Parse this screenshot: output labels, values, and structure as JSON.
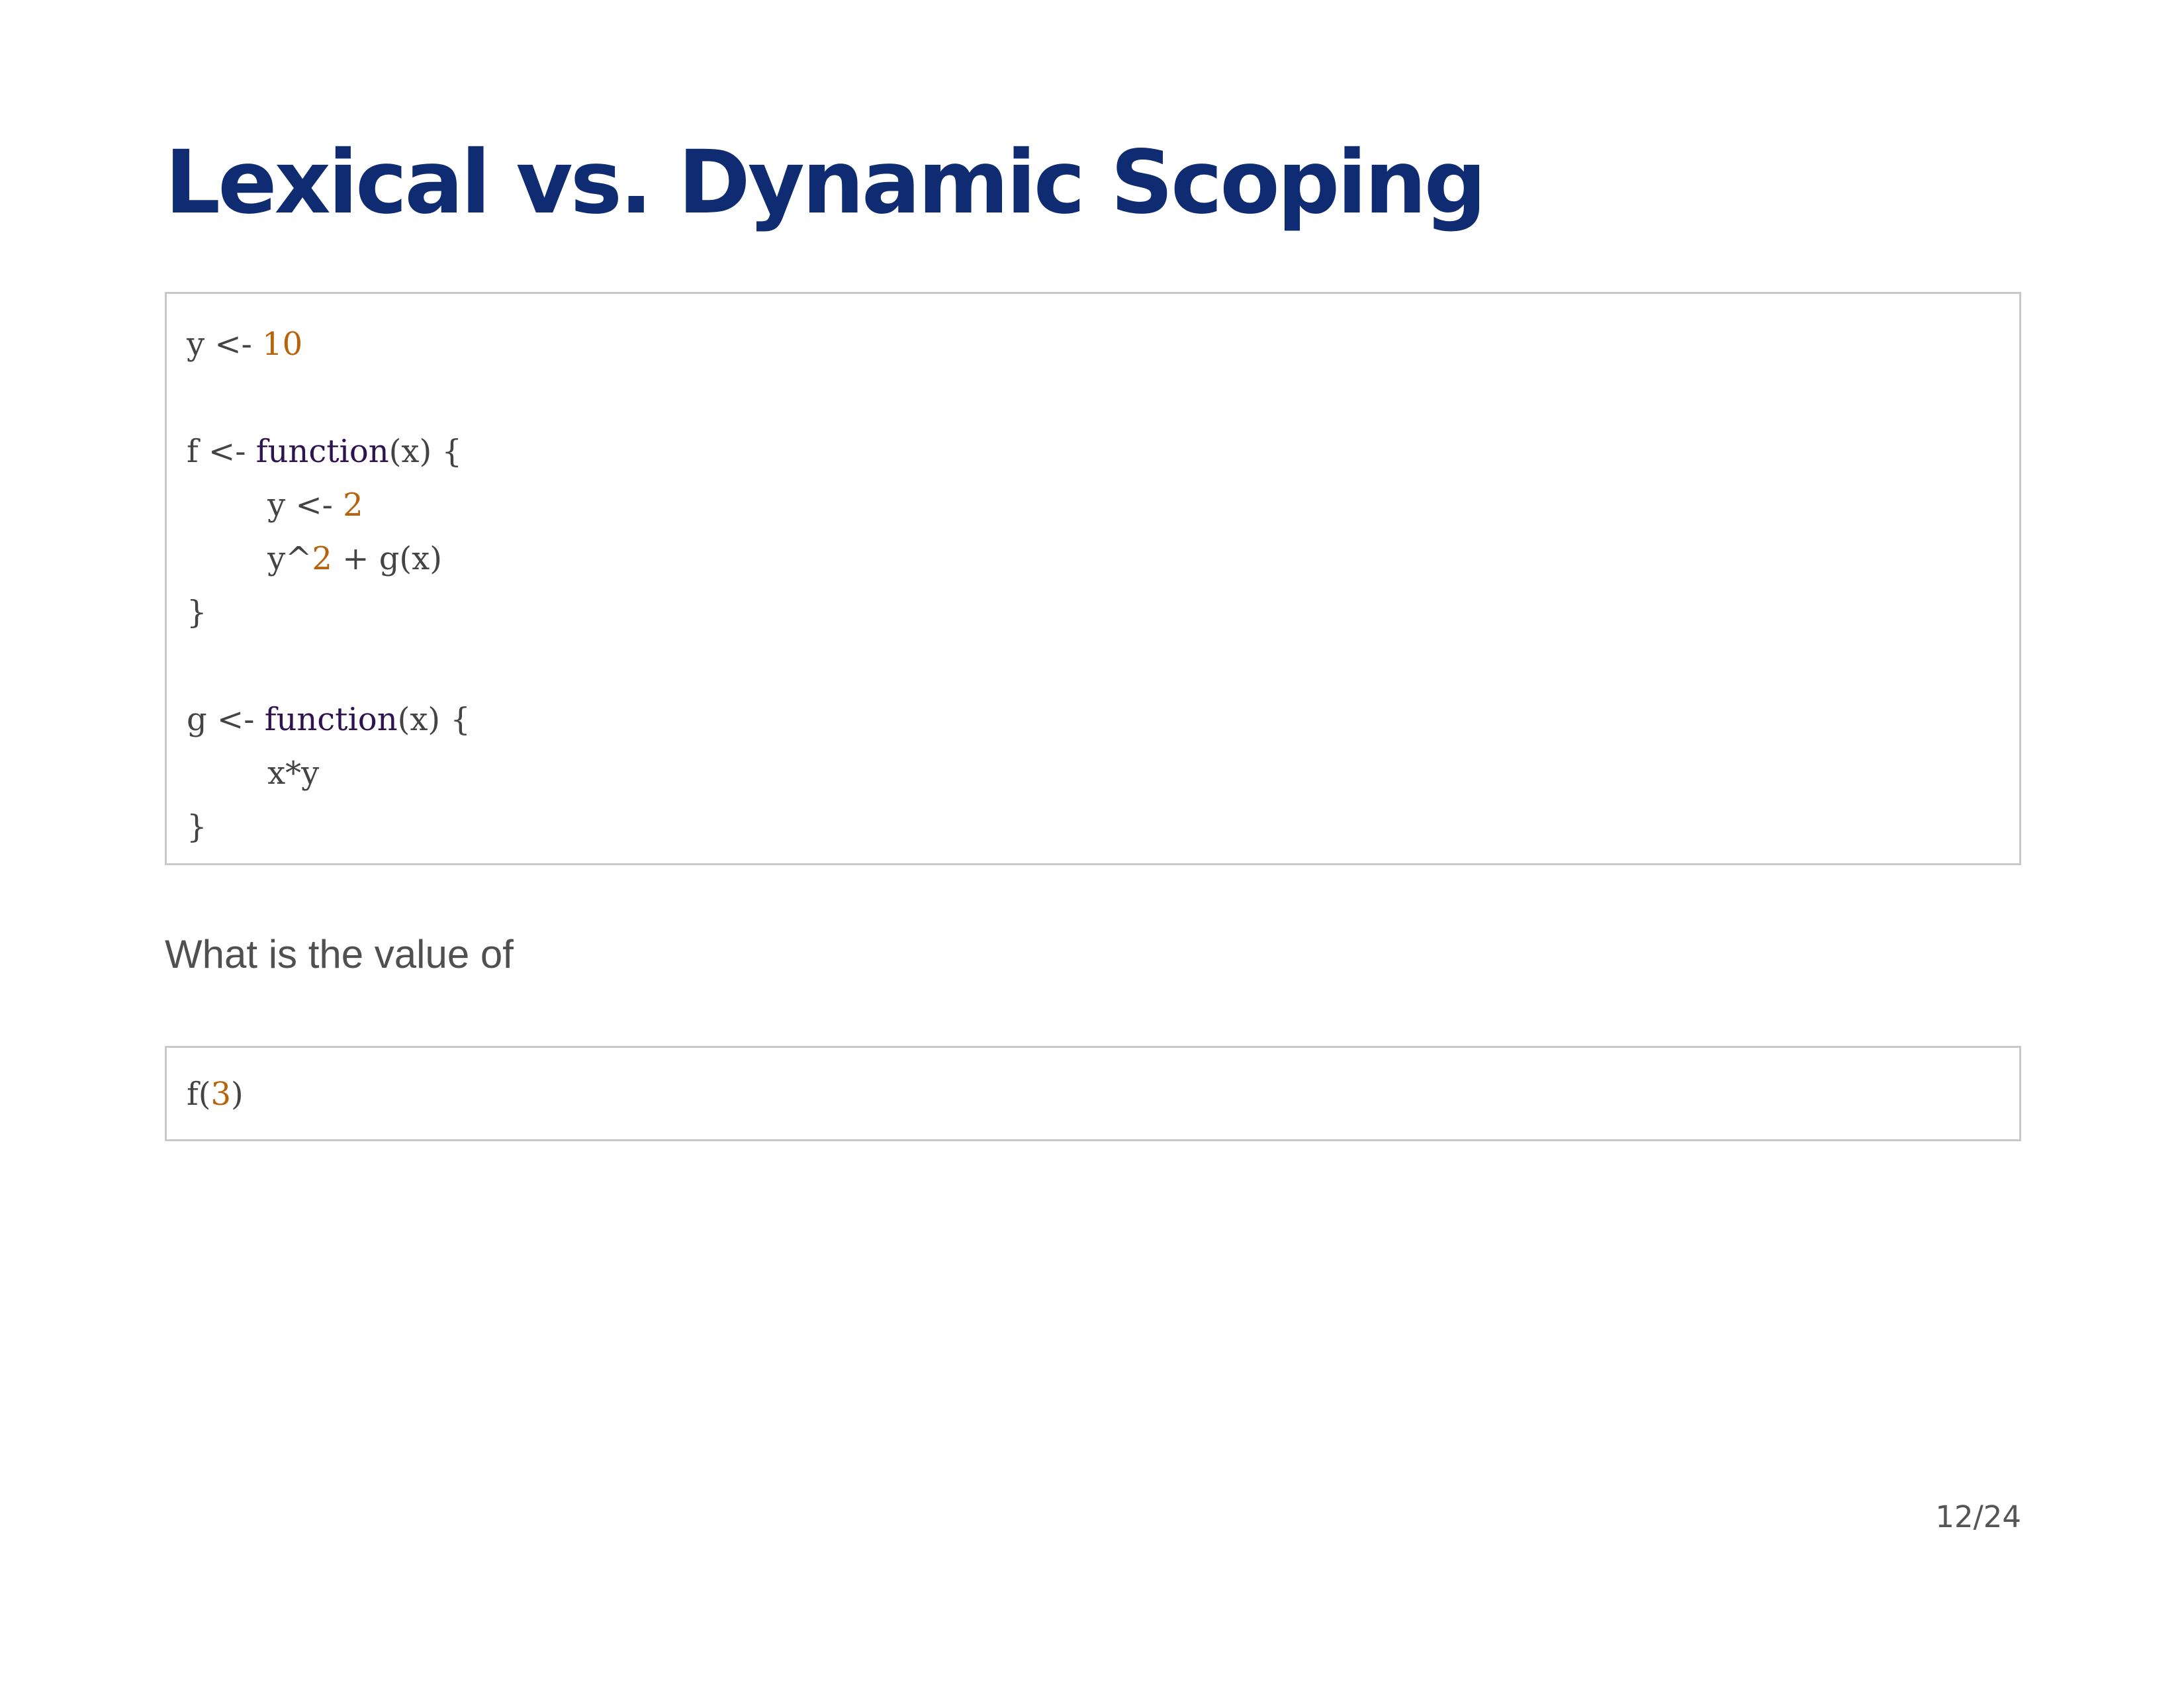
{
  "slide": {
    "title": "Lexical vs. Dynamic Scoping",
    "code_main": {
      "lines": [
        [
          {
            "t": "y <- ",
            "c": "plain"
          },
          {
            "t": "10",
            "c": "num"
          }
        ],
        [],
        [
          {
            "t": "f <- ",
            "c": "plain"
          },
          {
            "t": "function",
            "c": "kw"
          },
          {
            "t": "(x) {",
            "c": "plain"
          }
        ],
        [
          {
            "t": "        y <- ",
            "c": "plain"
          },
          {
            "t": "2",
            "c": "num"
          }
        ],
        [
          {
            "t": "        y^",
            "c": "plain"
          },
          {
            "t": "2",
            "c": "num"
          },
          {
            "t": " + g(x)",
            "c": "plain"
          }
        ],
        [
          {
            "t": "}",
            "c": "plain"
          }
        ],
        [],
        [
          {
            "t": "g <- ",
            "c": "plain"
          },
          {
            "t": "function",
            "c": "kw"
          },
          {
            "t": "(x) {",
            "c": "plain"
          }
        ],
        [
          {
            "t": "        x*y",
            "c": "plain"
          }
        ],
        [
          {
            "t": "}",
            "c": "plain"
          }
        ]
      ]
    },
    "question": "What is the value of",
    "code_call": {
      "lines": [
        [
          {
            "t": "f(",
            "c": "plain"
          },
          {
            "t": "3",
            "c": "num"
          },
          {
            "t": ")",
            "c": "plain"
          }
        ]
      ]
    },
    "page_number": "12/24"
  },
  "colors": {
    "title": "#0f2b72",
    "code_text": "#444444",
    "code_number": "#b8620b",
    "code_keyword": "#2d1450",
    "box_border": "#c9c9c9",
    "body_text": "#505050"
  }
}
